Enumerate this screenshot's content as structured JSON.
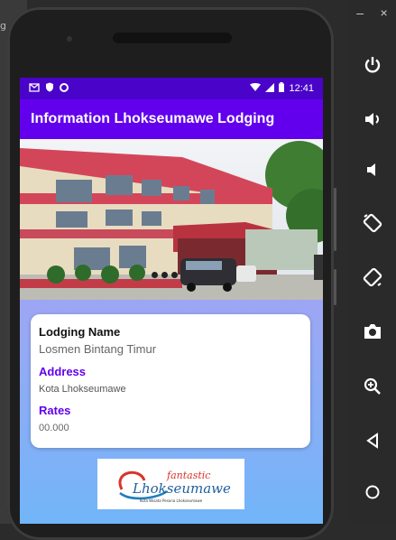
{
  "desktop": {
    "left_text": "g"
  },
  "status_bar": {
    "time": "12:41"
  },
  "app_bar": {
    "title": "Information Lhokseumawe Lodging"
  },
  "image_slider": {
    "page_count": 3,
    "active_index": 0
  },
  "card": {
    "name_label": "Lodging Name",
    "name_value": "Losmen Bintang Timur",
    "address_label": "Address",
    "address_value": "Kota Lhokseumawe",
    "rates_label": "Rates",
    "rates_value": "00.000"
  },
  "logo": {
    "text": "fantastic Lhokseumawe",
    "tagline": "Kota Wisata Pesona Lhokseumawe"
  },
  "emulator_toolbar": {
    "items": [
      "power-icon",
      "volume-up-icon",
      "volume-down-icon",
      "rotate-left-icon",
      "rotate-right-icon",
      "camera-icon",
      "zoom-icon",
      "back-icon",
      "home-icon"
    ],
    "window_controls": [
      "–",
      "×"
    ]
  },
  "colors": {
    "primary": "#6200ee",
    "status_bar": "#4a03c9",
    "accent_text": "#6200ee"
  }
}
